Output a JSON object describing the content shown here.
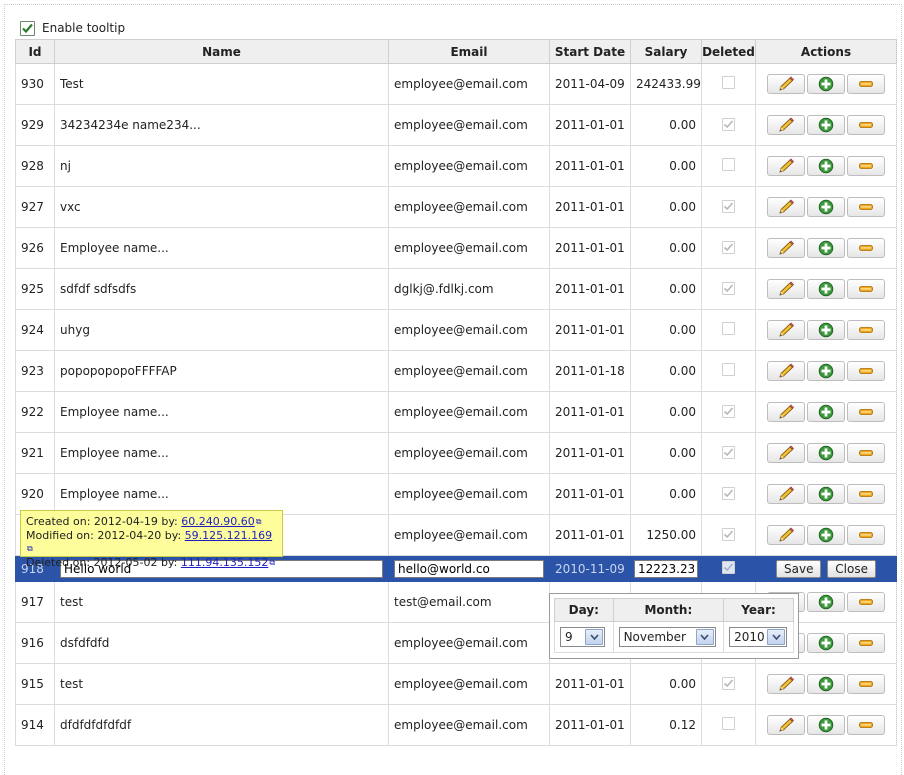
{
  "toolbar": {
    "enable_tooltip_label": "Enable tooltip",
    "enable_tooltip_checked": true
  },
  "columns": {
    "id": "Id",
    "name": "Name",
    "email": "Email",
    "start_date": "Start Date",
    "salary": "Salary",
    "deleted": "Deleted",
    "actions": "Actions"
  },
  "rows_top": [
    {
      "id": "930",
      "name": "Test",
      "email": "employee@email.com",
      "start_date": "2011-04-09",
      "salary": "242433.99",
      "deleted": false
    },
    {
      "id": "929",
      "name": "34234234e name234...",
      "email": "employee@email.com",
      "start_date": "2011-01-01",
      "salary": "0.00",
      "deleted": true
    },
    {
      "id": "928",
      "name": "nj",
      "email": "employee@email.com",
      "start_date": "2011-01-01",
      "salary": "0.00",
      "deleted": false
    },
    {
      "id": "927",
      "name": "vxc",
      "email": "employee@email.com",
      "start_date": "2011-01-01",
      "salary": "0.00",
      "deleted": true
    },
    {
      "id": "926",
      "name": "Employee name...",
      "email": "employee@email.com",
      "start_date": "2011-01-01",
      "salary": "0.00",
      "deleted": true
    },
    {
      "id": "925",
      "name": "sdfdf sdfsdfs",
      "email": "dglkj@.fdlkj.com",
      "start_date": "2011-01-01",
      "salary": "0.00",
      "deleted": true
    },
    {
      "id": "924",
      "name": "uhyg",
      "email": "employee@email.com",
      "start_date": "2011-01-01",
      "salary": "0.00",
      "deleted": false
    },
    {
      "id": "923",
      "name": "popopopopoFFFFAP",
      "email": "employee@email.com",
      "start_date": "2011-01-18",
      "salary": "0.00",
      "deleted": false
    },
    {
      "id": "922",
      "name": "Employee name...",
      "email": "employee@email.com",
      "start_date": "2011-01-01",
      "salary": "0.00",
      "deleted": true
    },
    {
      "id": "921",
      "name": "Employee name...",
      "email": "employee@email.com",
      "start_date": "2011-01-01",
      "salary": "0.00",
      "deleted": true
    },
    {
      "id": "920",
      "name": "Employee name...",
      "email": "employee@email.com",
      "start_date": "2011-01-01",
      "salary": "0.00",
      "deleted": true
    },
    {
      "id": "",
      "name": "",
      "email": "employee@email.com",
      "start_date": "2011-01-01",
      "salary": "1250.00",
      "deleted": true
    }
  ],
  "edit_row": {
    "id": "918",
    "name": "Hello world",
    "email": "hello@world.co",
    "start_date": "2010-11-09",
    "salary": "12223.23",
    "deleted": true,
    "save_label": "Save",
    "close_label": "Close"
  },
  "rows_bottom": [
    {
      "id": "917",
      "name": "test",
      "email": "test@email.com",
      "start_date": "",
      "salary": "",
      "deleted": false
    },
    {
      "id": "916",
      "name": "dsfdfdfd",
      "email": "employee@email.com",
      "start_date": "",
      "salary": "",
      "deleted": false
    },
    {
      "id": "915",
      "name": "test",
      "email": "employee@email.com",
      "start_date": "2011-01-01",
      "salary": "0.00",
      "deleted": true
    },
    {
      "id": "914",
      "name": "dfdfdfdfdfdf",
      "email": "employee@email.com",
      "start_date": "2011-01-01",
      "salary": "0.12",
      "deleted": false
    }
  ],
  "tooltip": {
    "created_prefix": "Created on: 2012-04-19 by: ",
    "created_ip": "60.240.90.60",
    "modified_prefix": "Modified on: 2012-04-20 by: ",
    "modified_ip": "59.125.121.169",
    "deleted_prefix": "Deleted on: 2012-05-02 by: ",
    "deleted_ip": "111.94.135.152"
  },
  "date_picker": {
    "day_label": "Day:",
    "month_label": "Month:",
    "year_label": "Year:",
    "day": "9",
    "month": "November",
    "year": "2010"
  },
  "colors": {
    "edit_row_bg": "#2b53a7",
    "tooltip_bg": "#fdfd9c",
    "header_bg": "#efefef"
  },
  "icons": {
    "edit": "pencil-icon",
    "add": "plus-icon",
    "delete": "minus-icon",
    "checked": "checkmark-icon"
  }
}
